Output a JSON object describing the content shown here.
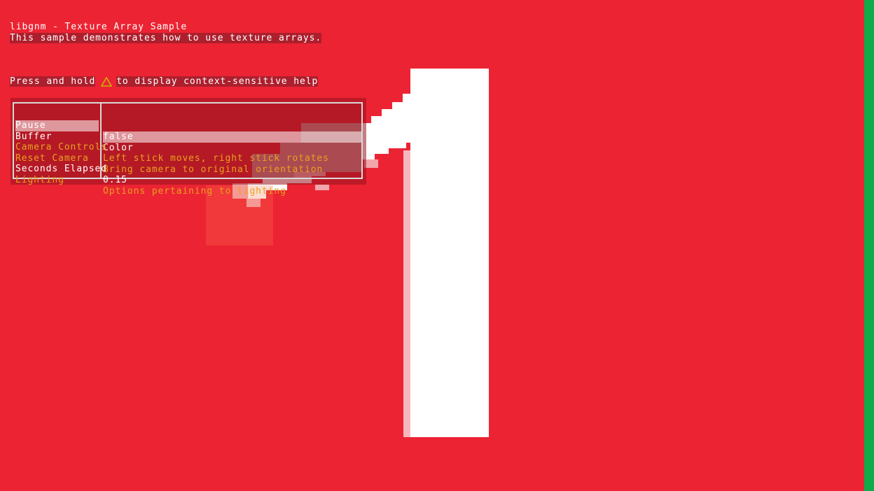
{
  "header": {
    "title": "libgnm - Texture Array Sample",
    "description": "This sample demonstrates how to use texture arrays.",
    "help_prefix": "Press and hold",
    "help_icon": "triangle-icon",
    "help_suffix": "to display context-sensitive help"
  },
  "menu": {
    "rows": [
      {
        "key": "Pause",
        "value": "false",
        "selected": true,
        "color": "white"
      },
      {
        "key": "Buffer",
        "value": "Color",
        "selected": false,
        "color": "white"
      },
      {
        "key": "Camera Controls",
        "value": "Left stick moves, right stick rotates",
        "selected": false,
        "color": "gold"
      },
      {
        "key": "Reset Camera",
        "value": "Bring camera to original orientation",
        "selected": false,
        "color": "gold"
      },
      {
        "key": "Seconds Elapsed",
        "value": "0.15",
        "selected": false,
        "color": "white"
      },
      {
        "key": "Lighting",
        "value": "Options pertaining to lighting",
        "selected": false,
        "color": "gold"
      }
    ]
  },
  "scene": {
    "texture_numeral": "1"
  },
  "colors": {
    "background": "#ec2333",
    "side_strip": "#0fab4b",
    "triangle_icon": "#c8b400",
    "menu_highlight": "#e6a21e"
  }
}
